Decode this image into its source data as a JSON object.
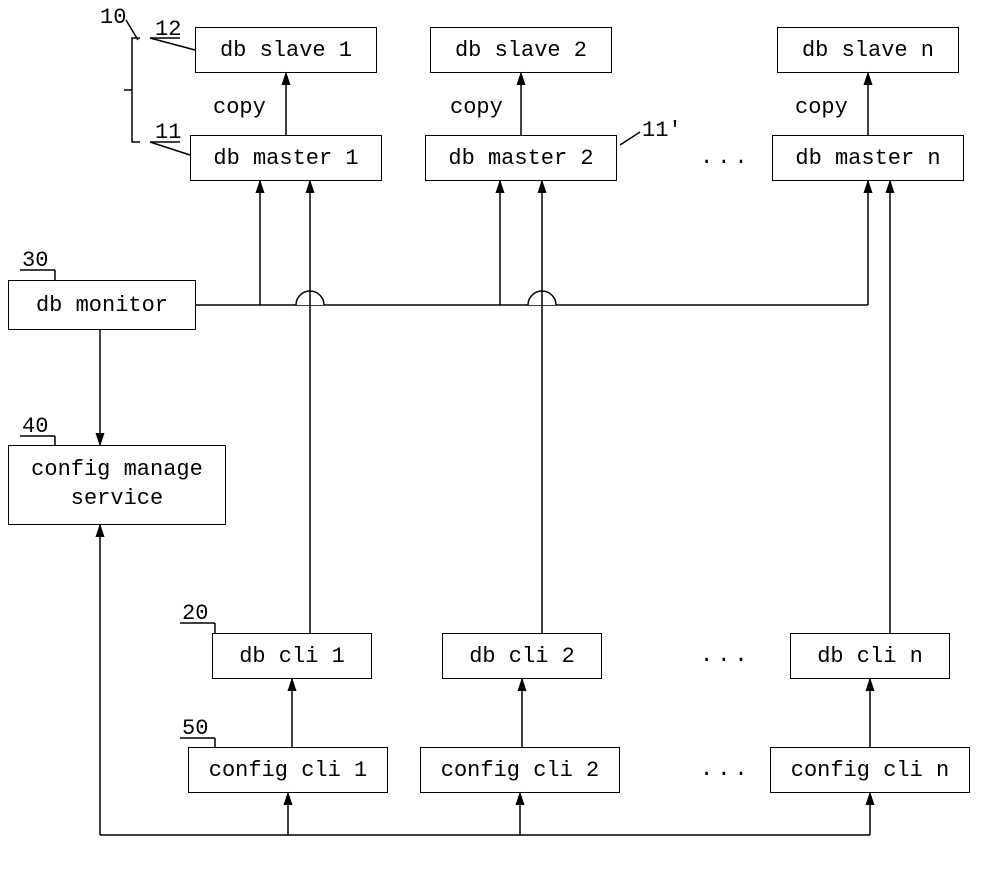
{
  "refs": {
    "r10": "10",
    "r11": "11",
    "r11p": "11'",
    "r12": "12",
    "r20": "20",
    "r30": "30",
    "r40": "40",
    "r50": "50"
  },
  "boxes": {
    "slave1": "db slave 1",
    "slave2": "db slave 2",
    "slaven": "db slave n",
    "master1": "db master 1",
    "master2": "db master 2",
    "mastern": "db master n",
    "monitor": "db monitor",
    "config_service": "config manage service",
    "cli1": "db cli 1",
    "cli2": "db cli 2",
    "clin": "db cli n",
    "cfgcli1": "config cli 1",
    "cfgcli2": "config cli 2",
    "cfgclin": "config cli n"
  },
  "labels": {
    "copy": "copy",
    "dots": "..."
  }
}
